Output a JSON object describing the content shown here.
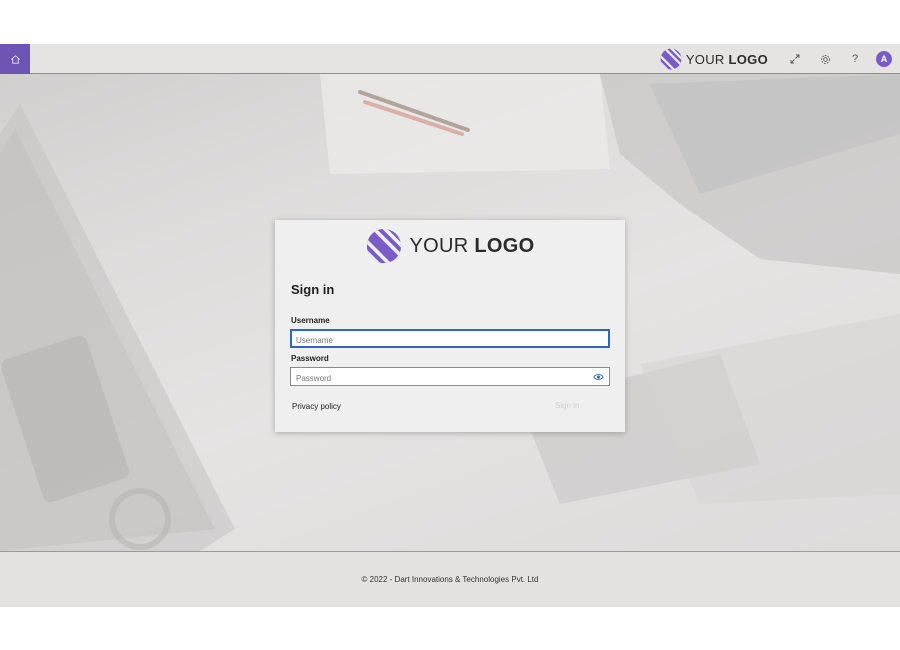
{
  "topbar": {
    "home_icon": "home-icon",
    "logo": {
      "text_light": "YOUR",
      "text_bold": "LOGO"
    },
    "icons": [
      "expand-icon",
      "settings-icon",
      "help-icon"
    ],
    "help_glyph": "?",
    "avatar_initial": "A"
  },
  "card": {
    "logo": {
      "text_light": "YOUR",
      "text_bold": "LOGO"
    },
    "title": "Sign in",
    "username": {
      "label": "Username",
      "placeholder": "Username",
      "value": ""
    },
    "password": {
      "label": "Password",
      "placeholder": "Password",
      "value": ""
    },
    "privacy_link": "Privacy policy",
    "signin_button": "Sign in"
  },
  "footer": {
    "text": "© 2022 - Dart Innovations & Technologies Pvt. Ltd"
  },
  "colors": {
    "accent": "#6e55b5",
    "focus": "#2b67c6",
    "logo": "#7a5cc7"
  }
}
